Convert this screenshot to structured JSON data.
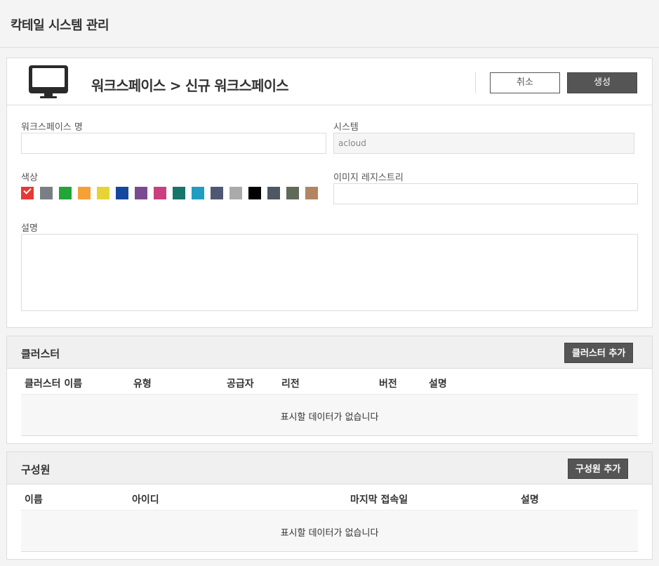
{
  "app": {
    "title": "칵테일 시스템 관리"
  },
  "workspace": {
    "breadcrumb": "워크스페이스 > 신규 워크스페이스",
    "cancel_label": "취소",
    "create_label": "생성",
    "name_label": "워크스페이스 명",
    "name_value": "",
    "system_label": "시스템",
    "system_value": "acloud",
    "color_label": "색상",
    "colors": [
      "#e53935",
      "#7a7f85",
      "#21a637",
      "#f5a138",
      "#e8d335",
      "#13489e",
      "#7b4a93",
      "#c93f7f",
      "#17756a",
      "#209ec1",
      "#4f5872",
      "#aaaaaa",
      "#000000",
      "#4d5863",
      "#5f6b58",
      "#b28560"
    ],
    "selected_color_index": 0,
    "registry_label": "이미지 레지스트리",
    "registry_value": "",
    "desc_label": "설명",
    "desc_value": ""
  },
  "clusters": {
    "title": "클러스터",
    "add_label": "클러스터 추가",
    "columns": [
      "클러스터 이름",
      "유형",
      "공급자",
      "리전",
      "버전",
      "설명"
    ],
    "empty_message": "표시할 데이터가 없습니다"
  },
  "members": {
    "title": "구성원",
    "add_label": "구성원 추가",
    "columns": [
      "이름",
      "아이디",
      "마지막 접속일",
      "설명"
    ],
    "empty_message": "표시할 데이터가 없습니다"
  }
}
